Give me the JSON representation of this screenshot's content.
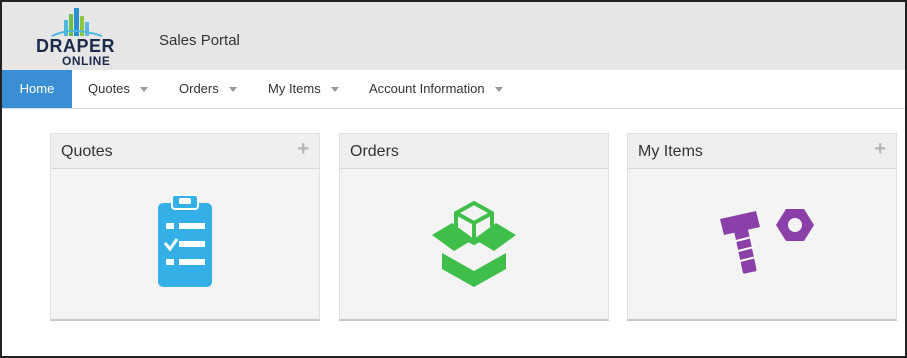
{
  "header": {
    "logo_word": "DRAPER",
    "logo_sub": "ONLINE",
    "portal_title": "Sales Portal"
  },
  "nav": {
    "items": [
      {
        "label": "Home",
        "active": true
      },
      {
        "label": "Quotes"
      },
      {
        "label": "Orders"
      },
      {
        "label": "My Items"
      },
      {
        "label": "Account Information"
      }
    ]
  },
  "cards": [
    {
      "title": "Quotes",
      "has_add": true,
      "add_label": "+",
      "icon": "clipboard-checklist-icon",
      "color": "#35b0e6"
    },
    {
      "title": "Orders",
      "has_add": false,
      "icon": "open-box-icon",
      "color": "#3fbf4a"
    },
    {
      "title": "My Items",
      "has_add": true,
      "add_label": "+",
      "icon": "bolt-nut-icon",
      "color": "#8b3fa8"
    }
  ],
  "colors": {
    "nav_active": "#3a8fd4",
    "header_bg": "#e6e6e6"
  }
}
